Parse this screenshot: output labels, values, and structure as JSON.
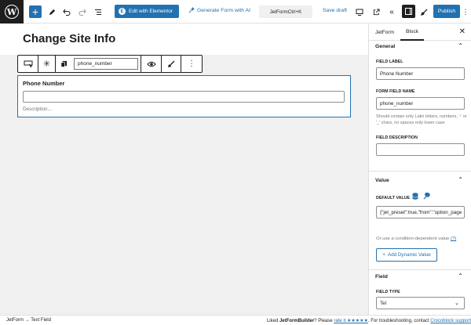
{
  "toolbar": {
    "add_icon": "plus-icon",
    "elementor_label": "Edit with Elementor",
    "generate_label": "Generate Form with AI",
    "command_center": "JetFormCtrl+K",
    "save_draft": "Save draft",
    "publish": "Publish",
    "icons": [
      "wordpress-icon",
      "pencil-icon",
      "undo-icon",
      "redo-icon",
      "list-view-icon",
      "desktop-icon",
      "external-link-icon",
      "collapse-icon",
      "sidebar-icon",
      "brush-icon",
      "more-icon"
    ]
  },
  "page": {
    "title": "Change Site Info"
  },
  "block_toolbar": {
    "field_name": "phone_number",
    "icons": [
      "field-icon",
      "required-icon",
      "copy-icon",
      "eye-icon",
      "brush-icon",
      "more-vertical-icon"
    ]
  },
  "field_block": {
    "label": "Phone Number",
    "input_value": "",
    "description": "Description..."
  },
  "sidebar": {
    "tabs": [
      "JetForm",
      "Block"
    ],
    "active_tab": "Block",
    "general": {
      "title": "General",
      "field_label_title": "FIELD LABEL",
      "field_label_value": "Phone Number",
      "form_field_name_title": "FORM FIELD NAME",
      "form_field_name_value": "phone_number",
      "help": "Should contain only Latin letters, numbers, '-' or '_' chars, no spaces only lower case",
      "field_description_title": "FIELD DESCRIPTION",
      "field_description_value": ""
    },
    "value": {
      "title": "Value",
      "default_value_title": "DEFAULT VALUE",
      "default_value": "{\"jet_preset\":true,\"from\":\"option_page",
      "condition_text": "Or use a condition-dependent value",
      "condition_help": "(?)",
      "add_dynamic": "Add Dynamic Value"
    },
    "field": {
      "title": "Field",
      "field_type_title": "FIELD TYPE",
      "field_type_value": "Tel"
    }
  },
  "footer": {
    "breadcrumb_1": "JetForm",
    "breadcrumb_sep": "→",
    "breadcrumb_2": "Text Field",
    "liked": "Liked",
    "brand": "JetFormBuilder",
    "please": "? Please",
    "rate": "rate it ★★★★★",
    "rest": ". For troubleshooting, contact",
    "support": "Crocoblock support"
  },
  "colors": {
    "accent": "#2271b1",
    "dark": "#1e1e1e",
    "canvas_bg": "#f0f0f0"
  }
}
